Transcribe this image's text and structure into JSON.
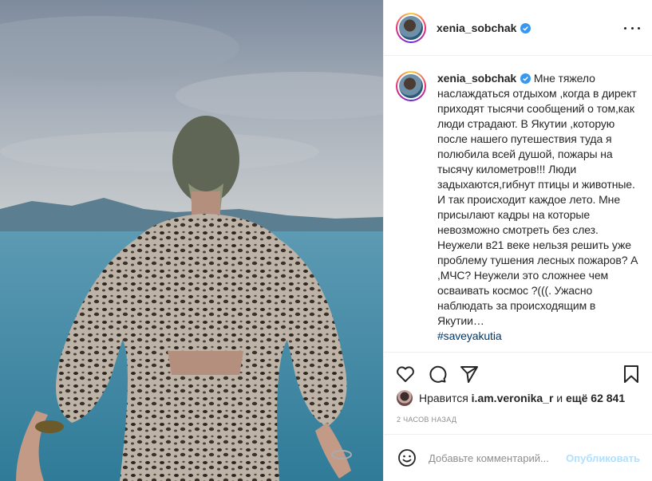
{
  "post": {
    "username": "xenia_sobchak",
    "caption": "Мне тяжело наслаждаться отдыхом ,когда в директ приходят тысячи сообщений о том,как люди страдают. В Якутии ,которую после нашего путешествия туда я полюбила всей душой, пожары на тысячу километров!!! Люди задыхаются,гибнут птицы и животные. И так происходит каждое лето. Мне присылают кадры на которые невозможно смотреть без слез. Неужели в21 веке нельзя решить уже проблему тушения лесных пожаров? А ,МЧС? Неужели это сложнее чем осваивать космос ?(((. Ужасно наблюдать за происходящим в Якутии…",
    "hashtag": "#saveyakutia",
    "caption_time": "2 ч",
    "likes_prefix": "Нравится",
    "likes_user": "i.am.veronika_r",
    "likes_joiner": "и",
    "likes_rest": "ещё 62 841",
    "posted_ago": "2 ЧАСОВ НАЗАД"
  },
  "comment": {
    "placeholder": "Добавьте комментарий...",
    "post_label": "Опубликовать"
  },
  "icons": {
    "verified": "verified-badge-icon",
    "more": "more-options-icon",
    "like": "heart-icon",
    "comment": "comment-icon",
    "share": "paper-plane-icon",
    "save": "bookmark-icon",
    "emoji": "smiley-icon"
  },
  "colors": {
    "verified_blue": "#3897f0",
    "hashtag": "#00376b",
    "muted": "#8e8e8e",
    "post_button": "#b2dffc"
  }
}
